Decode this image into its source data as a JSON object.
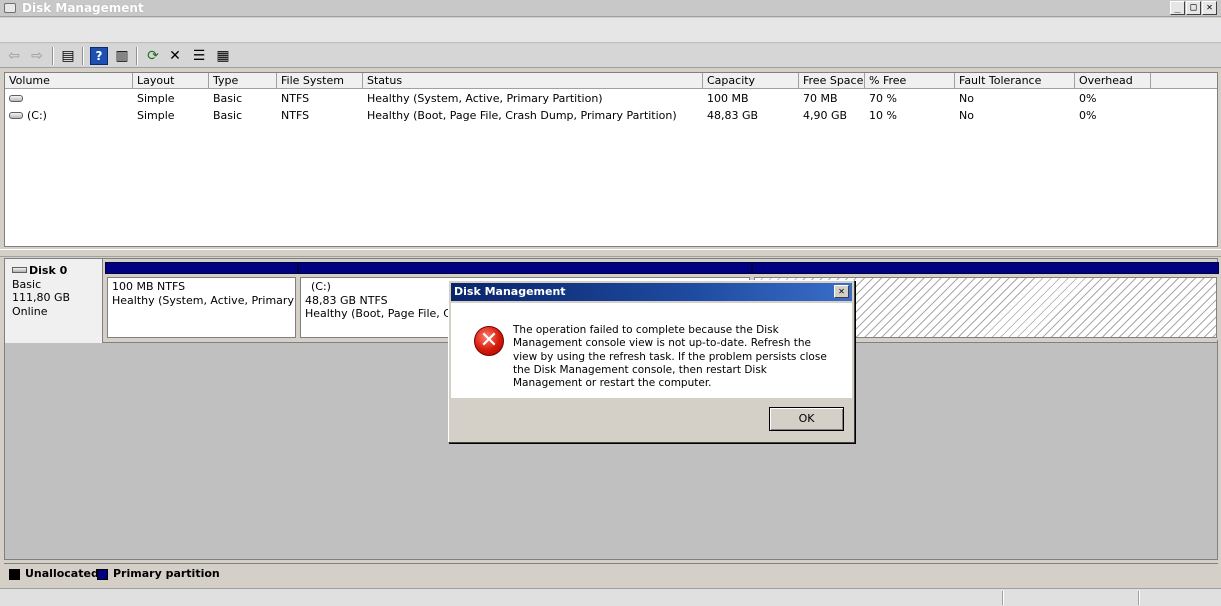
{
  "window": {
    "title": "Disk Management"
  },
  "toolbar": {
    "buttons": [
      {
        "icon": "back-arrow-icon",
        "glyph": "⇦"
      },
      {
        "icon": "forward-arrow-icon",
        "glyph": "⇨"
      },
      {
        "icon": "show-hide-tree-icon",
        "glyph": "▤"
      },
      {
        "icon": "help-icon",
        "glyph": "?"
      },
      {
        "icon": "properties-pane-icon",
        "glyph": "▥"
      },
      {
        "icon": "refresh-icon",
        "glyph": "⟳"
      },
      {
        "icon": "delete-icon",
        "glyph": "✕"
      },
      {
        "icon": "properties-icon",
        "glyph": "☰"
      },
      {
        "icon": "export-icon",
        "glyph": "▦"
      }
    ]
  },
  "volume_list": {
    "columns": [
      "Volume",
      "Layout",
      "Type",
      "File System",
      "Status",
      "Capacity",
      "Free Space",
      "% Free",
      "Fault Tolerance",
      "Overhead"
    ],
    "rows": [
      [
        "",
        "Simple",
        "Basic",
        "NTFS",
        "Healthy (System, Active, Primary Partition)",
        "100 MB",
        "70 MB",
        "70 %",
        "No",
        "0%"
      ],
      [
        "(C:)",
        "Simple",
        "Basic",
        "NTFS",
        "Healthy (Boot, Page File, Crash Dump, Primary Partition)",
        "48,83 GB",
        "4,90 GB",
        "10 %",
        "No",
        "0%"
      ]
    ]
  },
  "disk": {
    "name": "Disk 0",
    "type": "Basic",
    "size": "111,80 GB",
    "status": "Online",
    "partitions": [
      {
        "label": "",
        "size": "100 MB NTFS",
        "status": "Healthy (System, Active, Primary Par"
      },
      {
        "label": "(C:)",
        "size": "48,83 GB NTFS",
        "status": "Healthy (Boot, Page File, Cras"
      }
    ]
  },
  "legend": {
    "unallocated": "Unallocated",
    "primary": "Primary partition",
    "unallocated_color": "#000000",
    "primary_color": "#000080"
  },
  "dialog": {
    "title": "Disk Management",
    "icon": "error-icon",
    "message": "The operation failed to complete because the Disk Management console view is not up-to-date.  Refresh the view by using the refresh task. If the problem persists close the Disk Management console, then restart Disk Management or restart the computer.",
    "ok_label": "OK"
  }
}
